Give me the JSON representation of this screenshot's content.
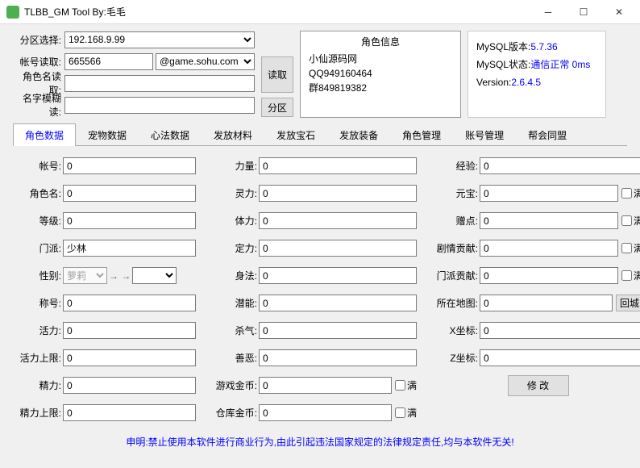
{
  "window": {
    "title": "TLBB_GM Tool By:毛毛"
  },
  "top": {
    "zone_label": "分区选择:",
    "zone_value": "192.168.9.99",
    "acct_label": "帐号读取:",
    "acct_value": "665566",
    "acct_domain": "@game.sohu.com",
    "char_label": "角色名读取:",
    "char_value": "",
    "blur_label": "名字模糊读:",
    "blur_value": "",
    "read_btn": "读取",
    "zone_btn": "分区"
  },
  "info": {
    "heading": "角色信息",
    "line1": "小仙源码网",
    "line2": "QQ949160464",
    "line3": "群849819382"
  },
  "status": {
    "mysql_ver_k": "MySQL版本:",
    "mysql_ver_v": "5.7.36",
    "mysql_st_k": "MySQL状态:",
    "mysql_st_v": "通信正常  0ms",
    "ver_k": "Version:",
    "ver_v": "2.6.4.5"
  },
  "tabs": [
    "角色数据",
    "宠物数据",
    "心法数据",
    "发放材料",
    "发放宝石",
    "发放装备",
    "角色管理",
    "账号管理",
    "帮会同盟"
  ],
  "col1": {
    "account": {
      "l": "帐号:",
      "v": "0"
    },
    "charname": {
      "l": "角色名:",
      "v": "0"
    },
    "level": {
      "l": "等级:",
      "v": "0"
    },
    "menpai": {
      "l": "门派:",
      "v": "少林"
    },
    "gender": {
      "l": "性别:",
      "v": "萝莉"
    },
    "title": {
      "l": "称号:",
      "v": "0"
    },
    "vigor": {
      "l": "活力:",
      "v": "0"
    },
    "vigor_max": {
      "l": "活力上限:",
      "v": "0"
    },
    "energy": {
      "l": "精力:",
      "v": "0"
    },
    "energy_max": {
      "l": "精力上限:",
      "v": "0"
    }
  },
  "col2": {
    "str": {
      "l": "力量:",
      "v": "0"
    },
    "spi": {
      "l": "灵力:",
      "v": "0"
    },
    "con": {
      "l": "体力:",
      "v": "0"
    },
    "ding": {
      "l": "定力:",
      "v": "0"
    },
    "agi": {
      "l": "身法:",
      "v": "0"
    },
    "pot": {
      "l": "潜能:",
      "v": "0"
    },
    "sha": {
      "l": "杀气:",
      "v": "0"
    },
    "good": {
      "l": "善恶:",
      "v": "0"
    },
    "gold": {
      "l": "游戏金币:",
      "v": "0"
    },
    "bank": {
      "l": "仓库金币:",
      "v": "0"
    }
  },
  "col3": {
    "exp": {
      "l": "经验:",
      "v": "0"
    },
    "yb": {
      "l": "元宝:",
      "v": "0"
    },
    "zd": {
      "l": "赠点:",
      "v": "0"
    },
    "juqing": {
      "l": "剧情贡献:",
      "v": "0"
    },
    "menpai_gx": {
      "l": "门派贡献:",
      "v": "0"
    },
    "map": {
      "l": "所在地图:",
      "v": "0"
    },
    "x": {
      "l": "X坐标:",
      "v": "0"
    },
    "z": {
      "l": "Z坐标:",
      "v": "0"
    }
  },
  "labels": {
    "full": "满",
    "back_city": "回城",
    "modify": "修 改"
  },
  "footer": "申明:禁止使用本软件进行商业行为,由此引起违法国家规定的法律规定责任,均与本软件无关!"
}
